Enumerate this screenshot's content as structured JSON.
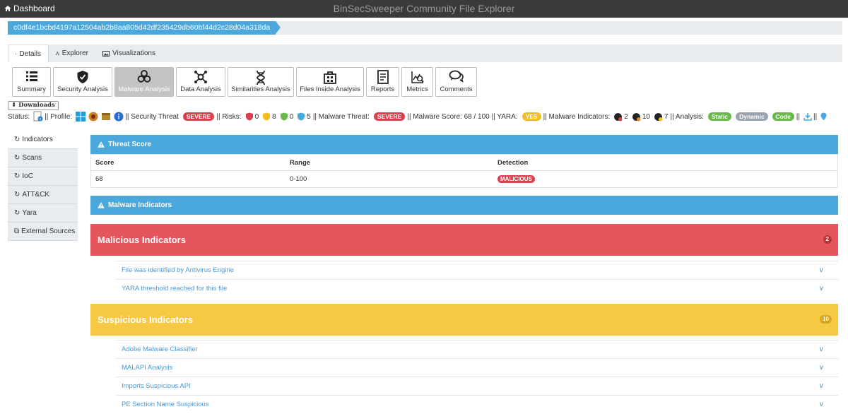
{
  "topbar": {
    "home_label": "Dashboard",
    "title": "BinSecSweeper Community File Explorer"
  },
  "hash": "c0df4e1bcbd4197a12504ab2b8aa805d42df235429db60bf44d2c28d04a318da",
  "tabs": [
    {
      "label": "Details",
      "icon": "info-circle-icon",
      "active": true
    },
    {
      "label": "Explorer",
      "icon": "sitemap-icon",
      "active": false
    },
    {
      "label": "Visualizations",
      "icon": "image-icon",
      "active": false
    }
  ],
  "analysis_buttons": [
    {
      "label": "Summary",
      "icon": "list-icon"
    },
    {
      "label": "Security Analysis",
      "icon": "shield-icon"
    },
    {
      "label": "Malware Analysis",
      "icon": "biohazard-icon",
      "active": true
    },
    {
      "label": "Data Analysis",
      "icon": "network-icon"
    },
    {
      "label": "Similarities Analysis",
      "icon": "dna-icon"
    },
    {
      "label": "Files Inside Analysis",
      "icon": "archive-icon"
    },
    {
      "label": "Reports",
      "icon": "report-icon"
    },
    {
      "label": "Metrics",
      "icon": "chart-search-icon"
    },
    {
      "label": "Comments",
      "icon": "comments-icon"
    }
  ],
  "downloads_label": "Downloads",
  "status": {
    "status_label": "Status:",
    "sep1": "|| Profile:",
    "security_threat_label": "|| Security Threat",
    "security_threat_value": "SEVERE",
    "risks_label": "|| Risks:",
    "risk_counts": [
      "0",
      "8",
      "0",
      "5"
    ],
    "malware_threat_label": "|| Malware Threat:",
    "malware_threat_value": "SEVERE",
    "malware_score_text": "|| Malware Score: 68 / 100 || YARA:",
    "yara_value": "YES",
    "indicators_label": "|| Malware Indicators:",
    "indicator_counts": [
      "2",
      "10",
      "7"
    ],
    "analysis_label": "|| Analysis:",
    "analysis_tags": [
      "Static",
      "Dynamic",
      "Code"
    ],
    "end_sep": "||"
  },
  "sidebar": {
    "items": [
      {
        "label": "Indicators",
        "active": true
      },
      {
        "label": "Scans"
      },
      {
        "label": "IoC"
      },
      {
        "label": "ATT&CK"
      },
      {
        "label": "Yara"
      },
      {
        "label": "External Sources"
      }
    ]
  },
  "threat_score": {
    "title": "Threat Score",
    "headers": [
      "Score",
      "Range",
      "Detection"
    ],
    "row": [
      "68",
      "0-100",
      "MALICIOUS"
    ]
  },
  "malware_indicators_title": "Malware Indicators",
  "malicious": {
    "title": "Malicious Indicators",
    "count": "2",
    "items": [
      "File was identified by Antivirus Engine",
      "YARA threshold reached for this file"
    ]
  },
  "suspicious": {
    "title": "Suspicious Indicators",
    "count": "10",
    "items": [
      "Adobe Malware Classifier",
      "MALAPI Analysis",
      "Imports Suspicious API",
      "PE Section Name Suspicious"
    ]
  },
  "colors": {
    "accent": "#4aa8dc",
    "danger": "#e4555c",
    "warning": "#f7c843",
    "topbar": "#3a3a3a"
  }
}
